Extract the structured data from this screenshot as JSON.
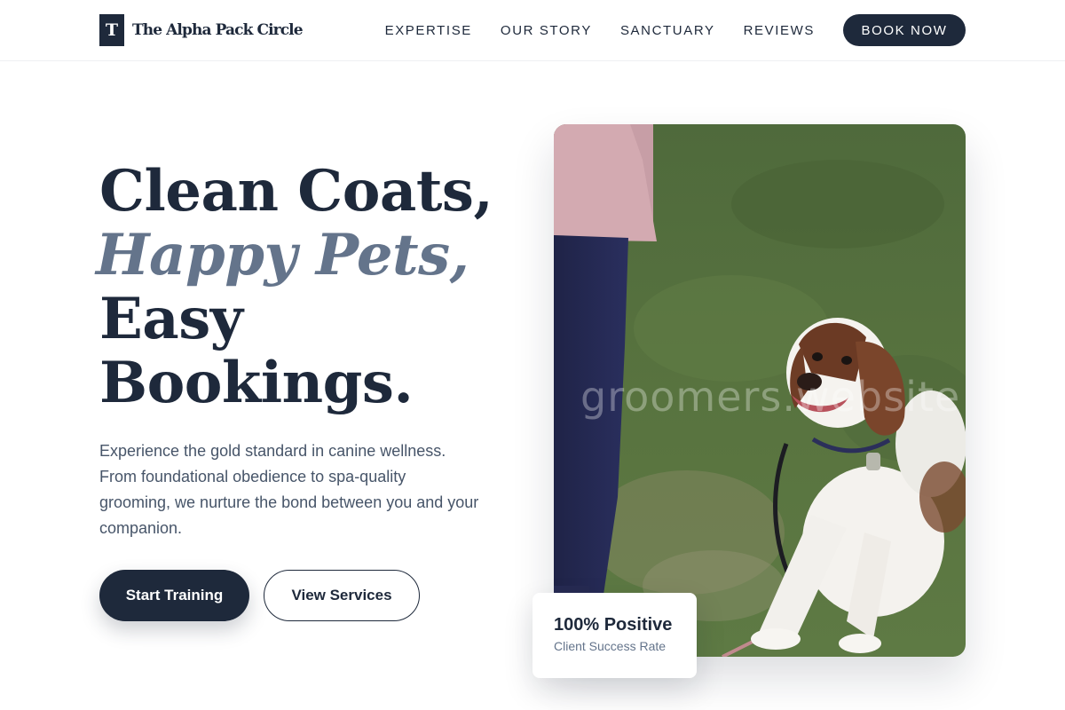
{
  "brand": {
    "mark": "T",
    "name": "The Alpha Pack Circle"
  },
  "nav": {
    "items": [
      {
        "label": "EXPERTISE"
      },
      {
        "label": "OUR STORY"
      },
      {
        "label": "SANCTUARY"
      },
      {
        "label": "REVIEWS"
      }
    ],
    "cta_label": "BOOK NOW"
  },
  "hero": {
    "title_line1": "Clean Coats,",
    "title_line2": "Happy Pets,",
    "title_line3": "Easy",
    "title_line4": "Bookings.",
    "description": "Experience the gold standard in canine wellness. From foundational obedience to spa-quality grooming, we nurture the bond between you and your companion.",
    "primary_button": "Start Training",
    "secondary_button": "View Services"
  },
  "photo": {
    "watermark": "groomers.website"
  },
  "stat": {
    "value": "100% Positive",
    "label": "Client Success Rate"
  },
  "colors": {
    "primary": "#1e293b",
    "accent_text": "#64748b",
    "body_text": "#475569",
    "background": "#ffffff"
  }
}
